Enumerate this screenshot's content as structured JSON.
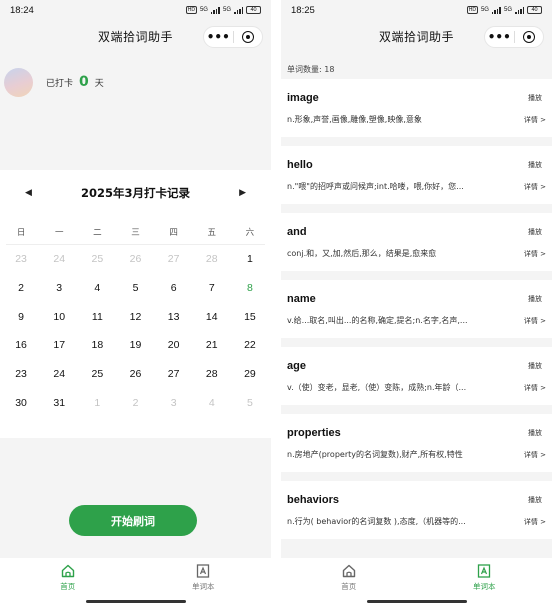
{
  "left": {
    "status": {
      "time": "18:24",
      "hd": "HD",
      "net": "5G",
      "battery": "40"
    },
    "title": "双端拾词助手",
    "capsule": {
      "more": "•••"
    },
    "checkin": {
      "prefix": "已打卡",
      "count": "0",
      "suffix": "天"
    },
    "calendar": {
      "prev": "◀",
      "next": "▶",
      "title": "2025年3月打卡记录",
      "weekdays": [
        "日",
        "一",
        "二",
        "三",
        "四",
        "五",
        "六"
      ],
      "days": [
        [
          "23",
          "24",
          "25",
          "26",
          "27",
          "28",
          "1"
        ],
        [
          "2",
          "3",
          "4",
          "5",
          "6",
          "7",
          "8"
        ],
        [
          "9",
          "10",
          "11",
          "12",
          "13",
          "14",
          "15"
        ],
        [
          "16",
          "17",
          "18",
          "19",
          "20",
          "21",
          "22"
        ],
        [
          "23",
          "24",
          "25",
          "26",
          "27",
          "28",
          "29"
        ],
        [
          "30",
          "31",
          "1",
          "2",
          "3",
          "4",
          "5"
        ]
      ],
      "highlight_color": "#2ea14a"
    },
    "start_button": "开始刷词",
    "tabs": [
      {
        "label": "首页",
        "icon": "home-icon"
      },
      {
        "label": "单词本",
        "icon": "wordbook-icon"
      }
    ]
  },
  "right": {
    "status": {
      "time": "18:25",
      "hd": "HD",
      "net": "5G",
      "battery": "40"
    },
    "title": "双端拾词助手",
    "capsule": {
      "more": "•••"
    },
    "word_count": "单词数量: 18",
    "play_label": "播放",
    "detail_label": "详情 >",
    "words": [
      {
        "word": "image",
        "def": "n.形象,声誉,画像,雕像,塑像,映像,意象"
      },
      {
        "word": "hello",
        "def": "n.\"喂\"的招呼声或问候声;int.哈喽，喂,你好，您..."
      },
      {
        "word": "and",
        "def": "conj.和，又,加,然后,那么，结果是,愈来愈"
      },
      {
        "word": "name",
        "def": "v.给...取名,叫出...的名称,确定,提名;n.名字,名声,..."
      },
      {
        "word": "age",
        "def": "v.（使）变老，显老,（使）变陈，成熟;n.年龄（..."
      },
      {
        "word": "properties",
        "def": "n.房地产(property的名词复数),财产,所有权,特性"
      },
      {
        "word": "behaviors",
        "def": "n.行为( behavior的名词复数 ),态度,（机器等的..."
      }
    ],
    "tabs": [
      {
        "label": "首页",
        "icon": "home-icon"
      },
      {
        "label": "单词本",
        "icon": "wordbook-icon"
      }
    ]
  },
  "colors": {
    "accent": "#2ea14a",
    "background": "#f4f4f4"
  }
}
